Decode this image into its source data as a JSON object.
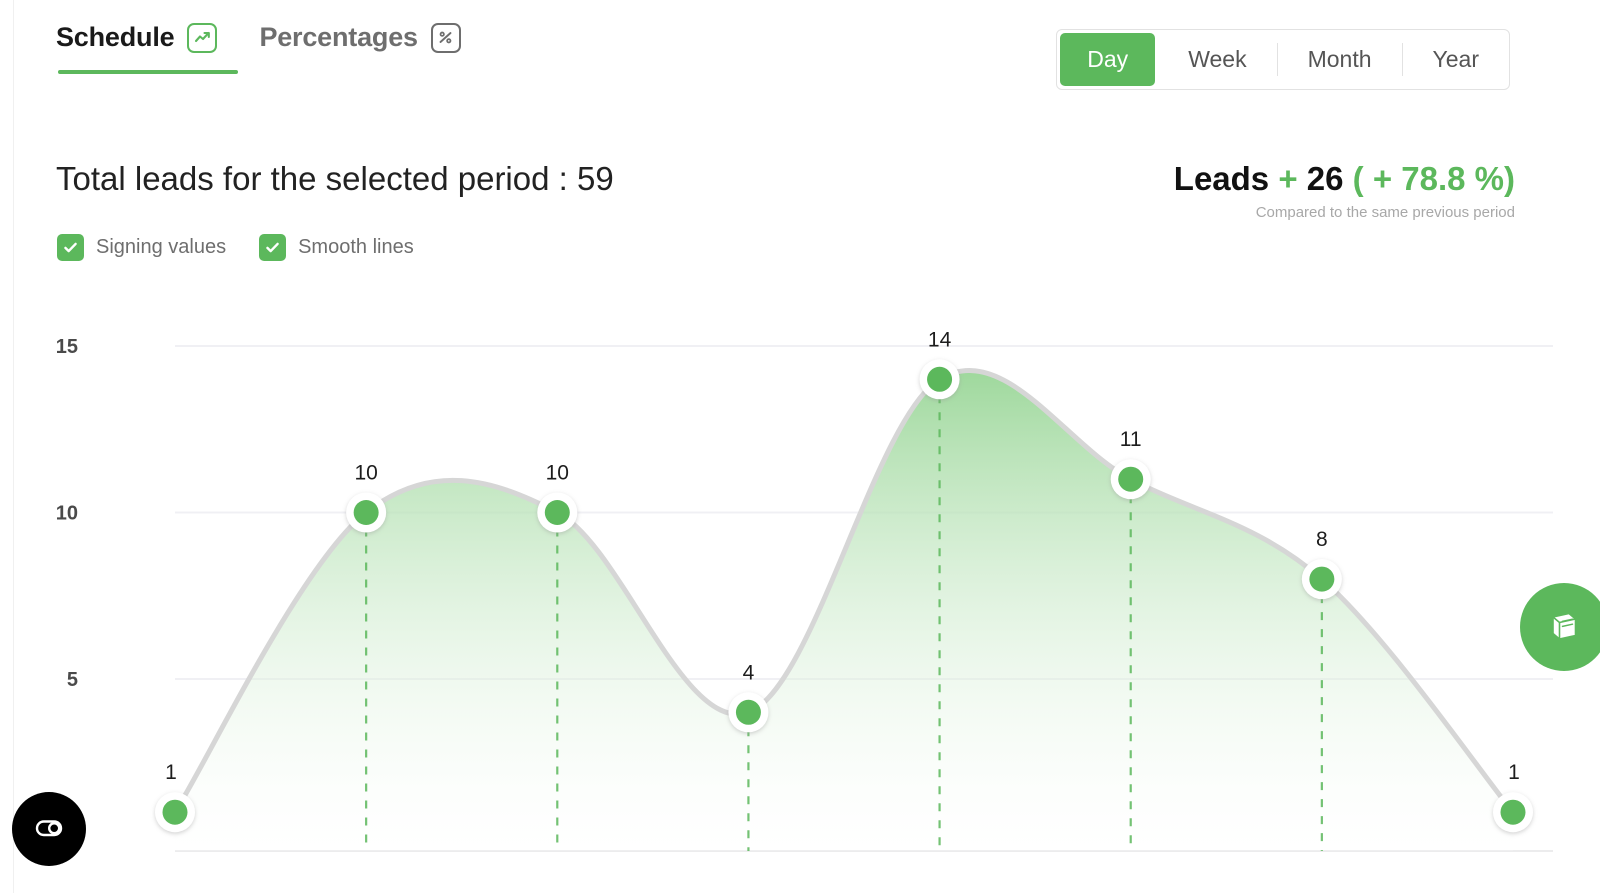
{
  "tabs": [
    {
      "label": "Schedule",
      "icon": "trend-up-icon",
      "active": true
    },
    {
      "label": "Percentages",
      "icon": "percent-icon",
      "active": false
    }
  ],
  "period_selector": {
    "options": [
      "Day",
      "Week",
      "Month",
      "Year"
    ],
    "selected": "Day"
  },
  "summary": {
    "title": "Total leads for the selected period : 59",
    "total_leads": 59,
    "checkboxes": [
      {
        "label": "Signing values",
        "checked": true
      },
      {
        "label": "Smooth lines",
        "checked": true
      }
    ]
  },
  "delta": {
    "metric": "Leads",
    "sign": "+",
    "value": "26",
    "percent_text": "( + 78.8 %)",
    "note": "Compared to the same previous period",
    "accent_color": "#5cb85c"
  },
  "buttons": {
    "manual_fab": {
      "icon": "book-icon",
      "color": "#5cb85c"
    },
    "accessibility_widget": {
      "icon": "toggle-icon",
      "color": "#000000"
    }
  },
  "chart_data": {
    "type": "area",
    "title": "Total leads for the selected period : 59",
    "xlabel": "",
    "ylabel": "",
    "ylim": [
      0,
      16
    ],
    "yticks": [
      5,
      10,
      15
    ],
    "ytick_labels": [
      "5",
      "10",
      "15"
    ],
    "grid": true,
    "legend": "none",
    "smooth": true,
    "show_values": true,
    "x": [
      1,
      2,
      3,
      4,
      5,
      6,
      7,
      8
    ],
    "categories": [
      "",
      "",
      "",
      "",
      "",
      "",
      "",
      ""
    ],
    "values": [
      1,
      10,
      10,
      4,
      14,
      11,
      8,
      1
    ],
    "point_labels": [
      "1",
      "10",
      "10",
      "4",
      "14",
      "11",
      "8",
      "1"
    ],
    "series": [
      {
        "name": "Leads",
        "values": [
          1,
          10,
          10,
          4,
          14,
          11,
          8,
          1
        ]
      }
    ],
    "line_color": "#d6d6d6",
    "marker_color": "#5cb85c",
    "marker_ring_color": "#ffffff",
    "fill_top_color": "#9ed89c",
    "fill_bottom_color": "#ffffff",
    "drop_line_color": "#5cb85c"
  }
}
